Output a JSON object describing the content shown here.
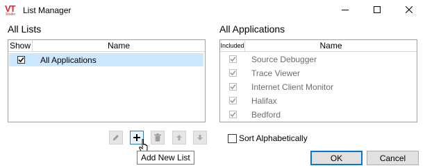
{
  "window": {
    "title": "List Manager",
    "logo_text": "VT",
    "logo_subtext": "Studio"
  },
  "all_lists": {
    "heading": "All Lists",
    "columns": {
      "show": "Show",
      "name": "Name"
    },
    "rows": [
      {
        "show": true,
        "name": "All Applications",
        "selected": true
      }
    ]
  },
  "all_applications": {
    "heading": "All Applications",
    "columns": {
      "included": "Included",
      "name": "Name"
    },
    "rows": [
      {
        "included": true,
        "name": "Source Debugger"
      },
      {
        "included": true,
        "name": "Trace Viewer"
      },
      {
        "included": true,
        "name": "Internet Client Monitor"
      },
      {
        "included": true,
        "name": "Halifax"
      },
      {
        "included": true,
        "name": "Bedford"
      }
    ]
  },
  "toolbar": {
    "edit_icon": "pencil-icon",
    "add_icon": "plus-icon",
    "delete_icon": "trash-icon",
    "move_up_icon": "arrow-up-icon",
    "move_down_icon": "arrow-down-icon",
    "tooltip": "Add New List"
  },
  "sort_alphabetically": {
    "label": "Sort Alphabetically",
    "checked": false
  },
  "buttons": {
    "ok": "OK",
    "cancel": "Cancel"
  },
  "colors": {
    "selection": "#cce8ff",
    "accent": "#0078d7",
    "disabled_text": "#6d6d6d"
  }
}
